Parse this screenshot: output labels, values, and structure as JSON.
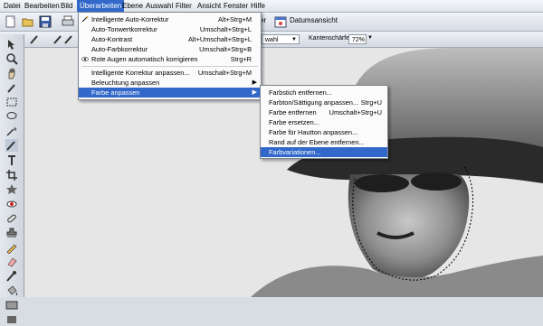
{
  "menubar": {
    "items": [
      "Datei",
      "Bearbeiten",
      "Bild",
      "Überarbeiten",
      "Ebene",
      "Auswahl",
      "Filter",
      "Ansicht",
      "Fenster",
      "Hilfe"
    ],
    "active": "Überarbeiten"
  },
  "toolbar": {
    "partial_label": "er",
    "datumsansicht_label": "Datumsansicht"
  },
  "options_bar": {
    "mode_value": "wahl",
    "edge_sharpness_label": "Kantenschärfe:",
    "edge_sharpness_value": "72%"
  },
  "main_menu": [
    {
      "label": "Intelligente Auto-Korrektur",
      "shortcut": "Alt+Strg+M",
      "icon": "auto-fix-icon"
    },
    {
      "label": "Auto-Tonwertkorrektur",
      "shortcut": "Umschalt+Strg+L"
    },
    {
      "label": "Auto-Kontrast",
      "shortcut": "Alt+Umschalt+Strg+L"
    },
    {
      "label": "Auto-Farbkorrektur",
      "shortcut": "Umschalt+Strg+B"
    },
    {
      "label": "Rote Augen automatisch korrigieren",
      "shortcut": "Strg+R",
      "icon": "red-eye-icon"
    },
    {
      "label": "Intelligente Korrektur anpassen...",
      "shortcut": "Umschalt+Strg+M"
    },
    {
      "label": "Beleuchtung anpassen",
      "submenu": true
    },
    {
      "label": "Farbe anpassen",
      "submenu": true,
      "highlighted": true
    }
  ],
  "sub_menu": [
    {
      "label": "Farbstich entfernen...",
      "shortcut": ""
    },
    {
      "label": "Farbton/Sättigung anpassen...",
      "shortcut": "Strg+U"
    },
    {
      "label": "Farbe entfernen",
      "shortcut": "Umschalt+Strg+U"
    },
    {
      "label": "Farbe ersetzen...",
      "shortcut": ""
    },
    {
      "label": "Farbe für Hautton anpassen...",
      "shortcut": ""
    },
    {
      "label": "Rand auf der Ebene entfernen...",
      "shortcut": ""
    },
    {
      "label": "Farbvariationen...",
      "shortcut": "",
      "highlighted": true
    }
  ],
  "colors": {
    "highlight": "#3168c9",
    "menu_bg": "#fbfbfb"
  }
}
